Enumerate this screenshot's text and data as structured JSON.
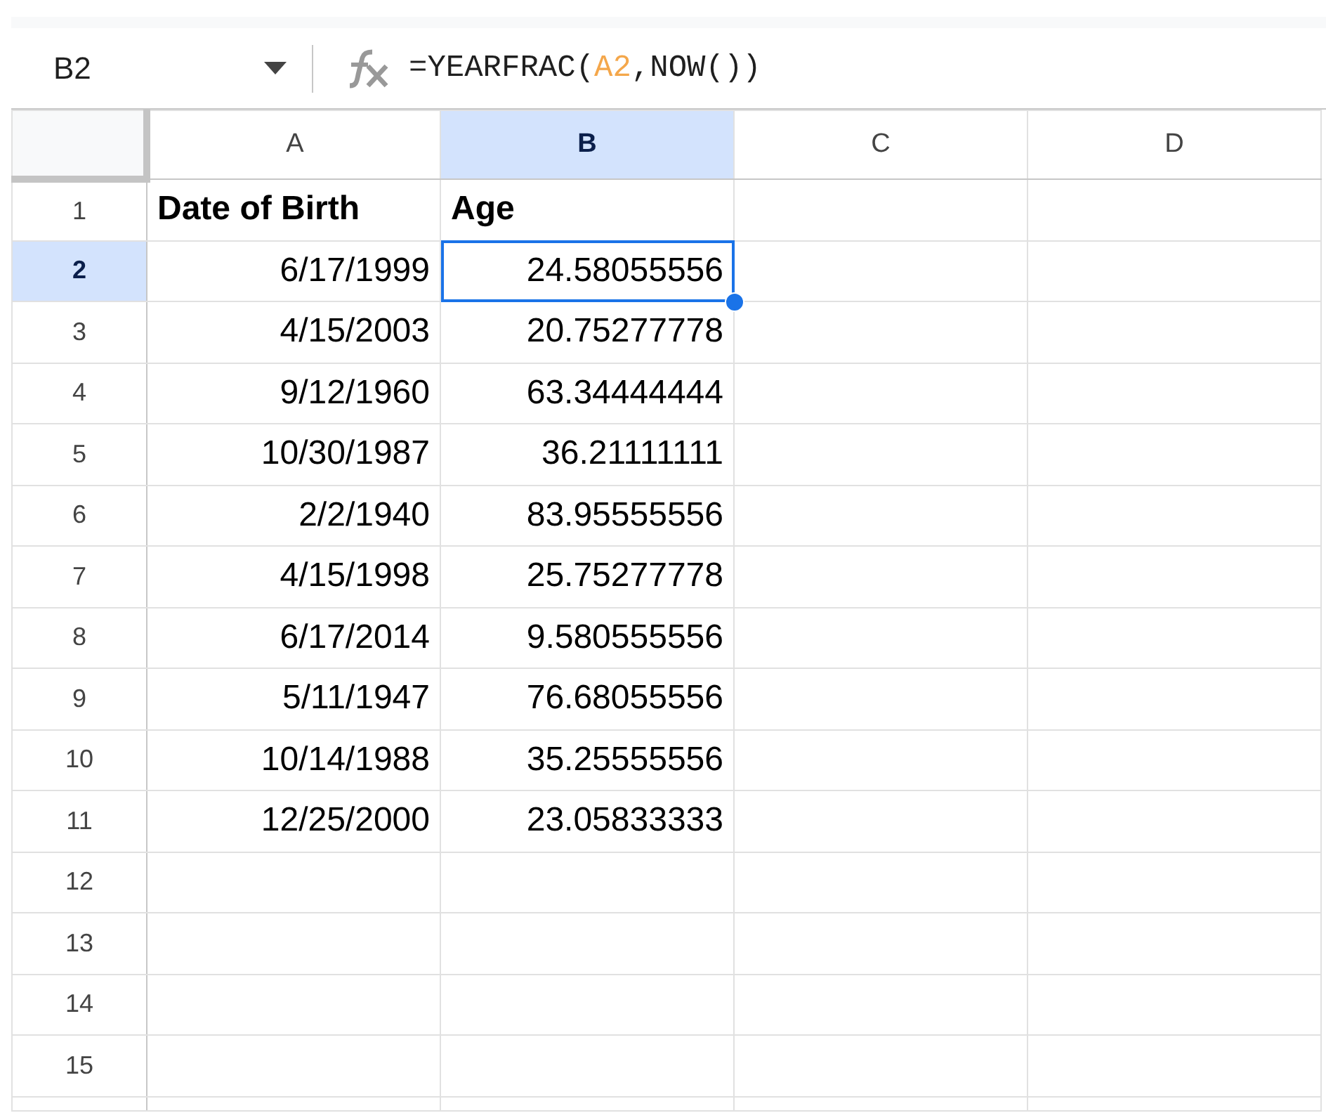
{
  "name_box": {
    "value": "B2"
  },
  "formula_bar": {
    "parts": [
      {
        "text": "=YEARFRAC(",
        "kind": "plain"
      },
      {
        "text": "A2",
        "kind": "reference",
        "color": "#f4a74b"
      },
      {
        "text": ",NOW())",
        "kind": "plain"
      }
    ]
  },
  "columns": [
    {
      "label": "A",
      "selected": false
    },
    {
      "label": "B",
      "selected": true
    },
    {
      "label": "C",
      "selected": false
    },
    {
      "label": "D",
      "selected": false
    }
  ],
  "rows": [
    {
      "number": "1",
      "selected": false,
      "kind": "header",
      "cells": [
        "Date of Birth",
        "Age",
        "",
        ""
      ]
    },
    {
      "number": "2",
      "selected": true,
      "kind": "data",
      "cells": [
        "6/17/1999",
        "24.58055556",
        "",
        ""
      ]
    },
    {
      "number": "3",
      "selected": false,
      "kind": "data",
      "cells": [
        "4/15/2003",
        "20.75277778",
        "",
        ""
      ]
    },
    {
      "number": "4",
      "selected": false,
      "kind": "data",
      "cells": [
        "9/12/1960",
        "63.34444444",
        "",
        ""
      ]
    },
    {
      "number": "5",
      "selected": false,
      "kind": "data",
      "cells": [
        "10/30/1987",
        "36.21111111",
        "",
        ""
      ]
    },
    {
      "number": "6",
      "selected": false,
      "kind": "data",
      "cells": [
        "2/2/1940",
        "83.95555556",
        "",
        ""
      ]
    },
    {
      "number": "7",
      "selected": false,
      "kind": "data",
      "cells": [
        "4/15/1998",
        "25.75277778",
        "",
        ""
      ]
    },
    {
      "number": "8",
      "selected": false,
      "kind": "data",
      "cells": [
        "6/17/2014",
        "9.580555556",
        "",
        ""
      ]
    },
    {
      "number": "9",
      "selected": false,
      "kind": "data",
      "cells": [
        "5/11/1947",
        "76.68055556",
        "",
        ""
      ]
    },
    {
      "number": "10",
      "selected": false,
      "kind": "data",
      "cells": [
        "10/14/1988",
        "35.25555556",
        "",
        ""
      ]
    },
    {
      "number": "11",
      "selected": false,
      "kind": "data",
      "cells": [
        "12/25/2000",
        "23.05833333",
        "",
        ""
      ]
    },
    {
      "number": "12",
      "selected": false,
      "kind": "data",
      "cells": [
        "",
        "",
        "",
        ""
      ]
    },
    {
      "number": "13",
      "selected": false,
      "kind": "data",
      "cells": [
        "",
        "",
        "",
        ""
      ]
    },
    {
      "number": "14",
      "selected": false,
      "kind": "data",
      "cells": [
        "",
        "",
        "",
        ""
      ]
    },
    {
      "number": "15",
      "selected": false,
      "kind": "data",
      "cells": [
        "",
        "",
        "",
        ""
      ]
    }
  ]
}
